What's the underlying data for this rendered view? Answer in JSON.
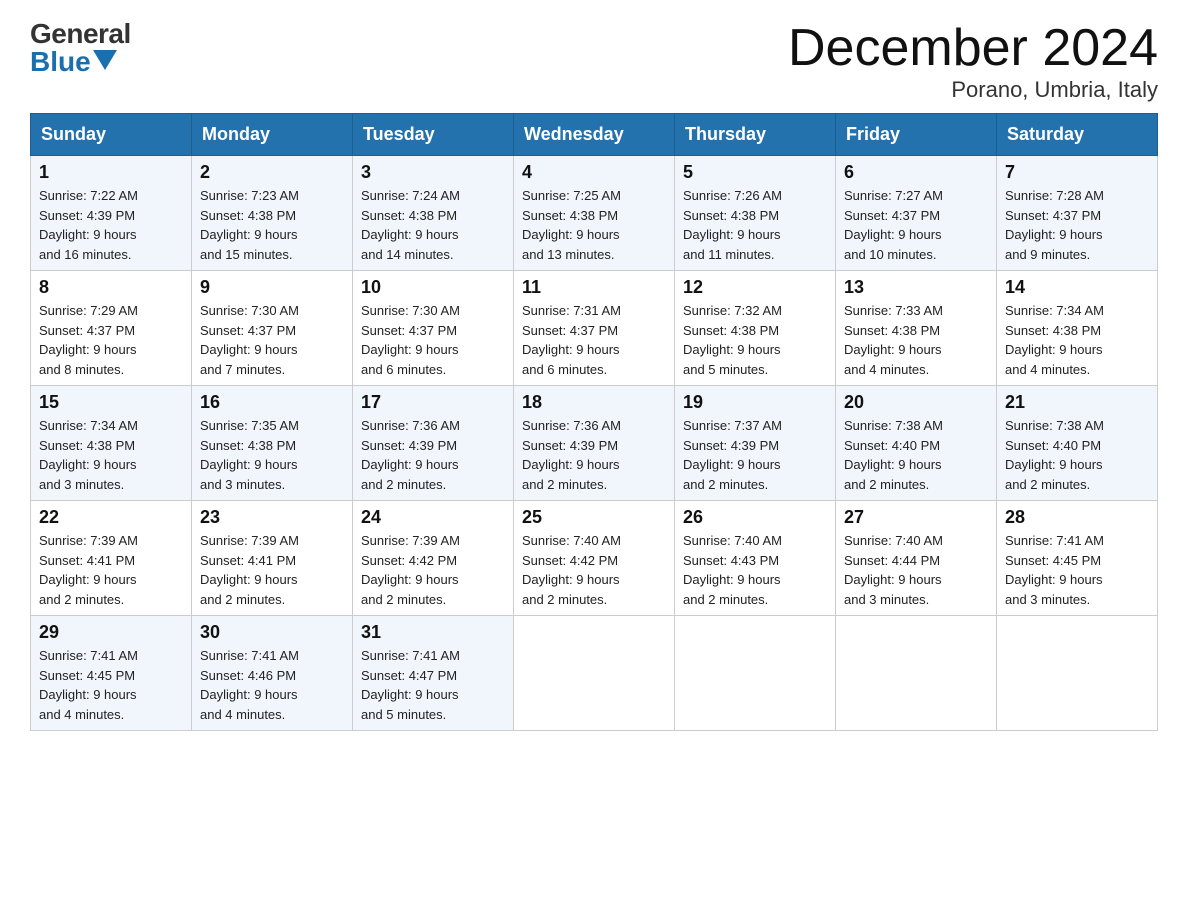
{
  "logo": {
    "general": "General",
    "blue": "Blue"
  },
  "title": {
    "month_year": "December 2024",
    "location": "Porano, Umbria, Italy"
  },
  "days_of_week": [
    "Sunday",
    "Monday",
    "Tuesday",
    "Wednesday",
    "Thursday",
    "Friday",
    "Saturday"
  ],
  "weeks": [
    [
      {
        "day": "1",
        "sunrise": "7:22 AM",
        "sunset": "4:39 PM",
        "daylight": "9 hours and 16 minutes."
      },
      {
        "day": "2",
        "sunrise": "7:23 AM",
        "sunset": "4:38 PM",
        "daylight": "9 hours and 15 minutes."
      },
      {
        "day": "3",
        "sunrise": "7:24 AM",
        "sunset": "4:38 PM",
        "daylight": "9 hours and 14 minutes."
      },
      {
        "day": "4",
        "sunrise": "7:25 AM",
        "sunset": "4:38 PM",
        "daylight": "9 hours and 13 minutes."
      },
      {
        "day": "5",
        "sunrise": "7:26 AM",
        "sunset": "4:38 PM",
        "daylight": "9 hours and 11 minutes."
      },
      {
        "day": "6",
        "sunrise": "7:27 AM",
        "sunset": "4:37 PM",
        "daylight": "9 hours and 10 minutes."
      },
      {
        "day": "7",
        "sunrise": "7:28 AM",
        "sunset": "4:37 PM",
        "daylight": "9 hours and 9 minutes."
      }
    ],
    [
      {
        "day": "8",
        "sunrise": "7:29 AM",
        "sunset": "4:37 PM",
        "daylight": "9 hours and 8 minutes."
      },
      {
        "day": "9",
        "sunrise": "7:30 AM",
        "sunset": "4:37 PM",
        "daylight": "9 hours and 7 minutes."
      },
      {
        "day": "10",
        "sunrise": "7:30 AM",
        "sunset": "4:37 PM",
        "daylight": "9 hours and 6 minutes."
      },
      {
        "day": "11",
        "sunrise": "7:31 AM",
        "sunset": "4:37 PM",
        "daylight": "9 hours and 6 minutes."
      },
      {
        "day": "12",
        "sunrise": "7:32 AM",
        "sunset": "4:38 PM",
        "daylight": "9 hours and 5 minutes."
      },
      {
        "day": "13",
        "sunrise": "7:33 AM",
        "sunset": "4:38 PM",
        "daylight": "9 hours and 4 minutes."
      },
      {
        "day": "14",
        "sunrise": "7:34 AM",
        "sunset": "4:38 PM",
        "daylight": "9 hours and 4 minutes."
      }
    ],
    [
      {
        "day": "15",
        "sunrise": "7:34 AM",
        "sunset": "4:38 PM",
        "daylight": "9 hours and 3 minutes."
      },
      {
        "day": "16",
        "sunrise": "7:35 AM",
        "sunset": "4:38 PM",
        "daylight": "9 hours and 3 minutes."
      },
      {
        "day": "17",
        "sunrise": "7:36 AM",
        "sunset": "4:39 PM",
        "daylight": "9 hours and 2 minutes."
      },
      {
        "day": "18",
        "sunrise": "7:36 AM",
        "sunset": "4:39 PM",
        "daylight": "9 hours and 2 minutes."
      },
      {
        "day": "19",
        "sunrise": "7:37 AM",
        "sunset": "4:39 PM",
        "daylight": "9 hours and 2 minutes."
      },
      {
        "day": "20",
        "sunrise": "7:38 AM",
        "sunset": "4:40 PM",
        "daylight": "9 hours and 2 minutes."
      },
      {
        "day": "21",
        "sunrise": "7:38 AM",
        "sunset": "4:40 PM",
        "daylight": "9 hours and 2 minutes."
      }
    ],
    [
      {
        "day": "22",
        "sunrise": "7:39 AM",
        "sunset": "4:41 PM",
        "daylight": "9 hours and 2 minutes."
      },
      {
        "day": "23",
        "sunrise": "7:39 AM",
        "sunset": "4:41 PM",
        "daylight": "9 hours and 2 minutes."
      },
      {
        "day": "24",
        "sunrise": "7:39 AM",
        "sunset": "4:42 PM",
        "daylight": "9 hours and 2 minutes."
      },
      {
        "day": "25",
        "sunrise": "7:40 AM",
        "sunset": "4:42 PM",
        "daylight": "9 hours and 2 minutes."
      },
      {
        "day": "26",
        "sunrise": "7:40 AM",
        "sunset": "4:43 PM",
        "daylight": "9 hours and 2 minutes."
      },
      {
        "day": "27",
        "sunrise": "7:40 AM",
        "sunset": "4:44 PM",
        "daylight": "9 hours and 3 minutes."
      },
      {
        "day": "28",
        "sunrise": "7:41 AM",
        "sunset": "4:45 PM",
        "daylight": "9 hours and 3 minutes."
      }
    ],
    [
      {
        "day": "29",
        "sunrise": "7:41 AM",
        "sunset": "4:45 PM",
        "daylight": "9 hours and 4 minutes."
      },
      {
        "day": "30",
        "sunrise": "7:41 AM",
        "sunset": "4:46 PM",
        "daylight": "9 hours and 4 minutes."
      },
      {
        "day": "31",
        "sunrise": "7:41 AM",
        "sunset": "4:47 PM",
        "daylight": "9 hours and 5 minutes."
      },
      null,
      null,
      null,
      null
    ]
  ],
  "labels": {
    "sunrise": "Sunrise:",
    "sunset": "Sunset:",
    "daylight": "Daylight:"
  }
}
